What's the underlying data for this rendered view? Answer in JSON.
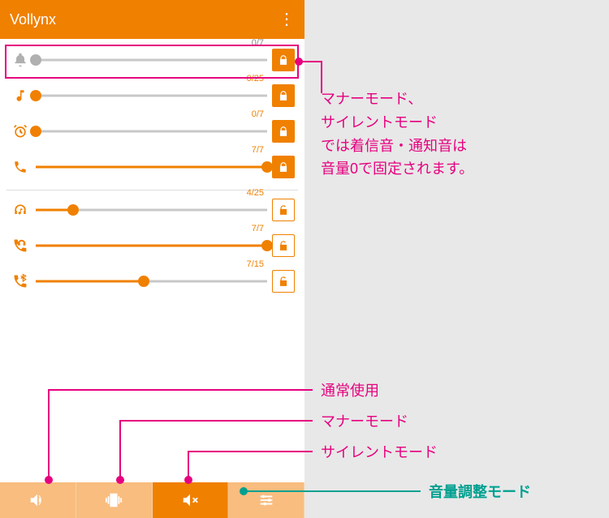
{
  "header": {
    "title": "Vollynx"
  },
  "colors": {
    "orange": "#f08000",
    "light_orange": "#f8bd7f",
    "gray": "#b0b0b0",
    "gray_text": "#888",
    "pink": "#e6007e",
    "teal": "#00a090"
  },
  "sliders": [
    {
      "id": "ring",
      "icon": "bell-icon",
      "value": 0,
      "max": 7,
      "label": "0/7",
      "enabled": false,
      "locked": true
    },
    {
      "id": "media",
      "icon": "note-icon",
      "value": 0,
      "max": 25,
      "label": "0/25",
      "enabled": true,
      "locked": true
    },
    {
      "id": "alarm",
      "icon": "clock-icon",
      "value": 0,
      "max": 7,
      "label": "0/7",
      "enabled": true,
      "locked": true
    },
    {
      "id": "call",
      "icon": "phone-icon",
      "value": 7,
      "max": 7,
      "label": "7/7",
      "enabled": true,
      "locked": true
    },
    {
      "id": "hp-media",
      "icon": "headphone-note-icon",
      "value": 4,
      "max": 25,
      "label": "4/25",
      "enabled": true,
      "locked": false
    },
    {
      "id": "hp-call",
      "icon": "phone-headphone-icon",
      "value": 7,
      "max": 7,
      "label": "7/7",
      "enabled": true,
      "locked": false
    },
    {
      "id": "bt-call",
      "icon": "phone-bt-icon",
      "value": 7,
      "max": 15,
      "label": "7/15",
      "enabled": true,
      "locked": false
    }
  ],
  "nav": [
    {
      "id": "normal",
      "icon": "speaker-icon",
      "style": "light"
    },
    {
      "id": "manner",
      "icon": "vibrate-icon",
      "style": "light"
    },
    {
      "id": "silent",
      "icon": "mute-icon",
      "style": "active"
    },
    {
      "id": "adjust",
      "icon": "sliders-icon",
      "style": "light"
    }
  ],
  "annotations": {
    "top": "マナーモード、\nサイレントモード\nでは着信音・通知音は\n音量0で固定されます。",
    "normal": "通常使用",
    "manner": "マナーモード",
    "silent": "サイレントモード",
    "adjust": "音量調整モード"
  }
}
